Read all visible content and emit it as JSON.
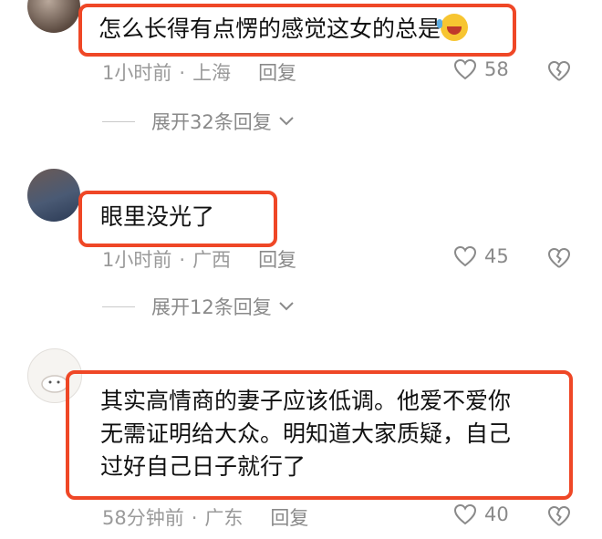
{
  "comments": [
    {
      "text": "怎么长得有点愣的感觉这女的总是",
      "emoji": "rofl-emoji",
      "time": "1小时前",
      "location": "上海",
      "reply_label": "回复",
      "likes": "58",
      "expand_label": "展开32条回复"
    },
    {
      "text": "眼里没光了",
      "time": "1小时前",
      "location": "广西",
      "reply_label": "回复",
      "likes": "45",
      "expand_label": "展开12条回复"
    },
    {
      "text_lines": [
        "其实高情商的妻子应该低调。他爱不爱你",
        "无需证明给大众。明知道大家质疑，自己",
        "过好自己日子就行了"
      ],
      "time": "58分钟前",
      "location": "广东",
      "reply_label": "回复",
      "likes": "40"
    }
  ],
  "separator": "·",
  "colors": {
    "highlight": "#ef4726",
    "meta": "#9a9a9a"
  }
}
